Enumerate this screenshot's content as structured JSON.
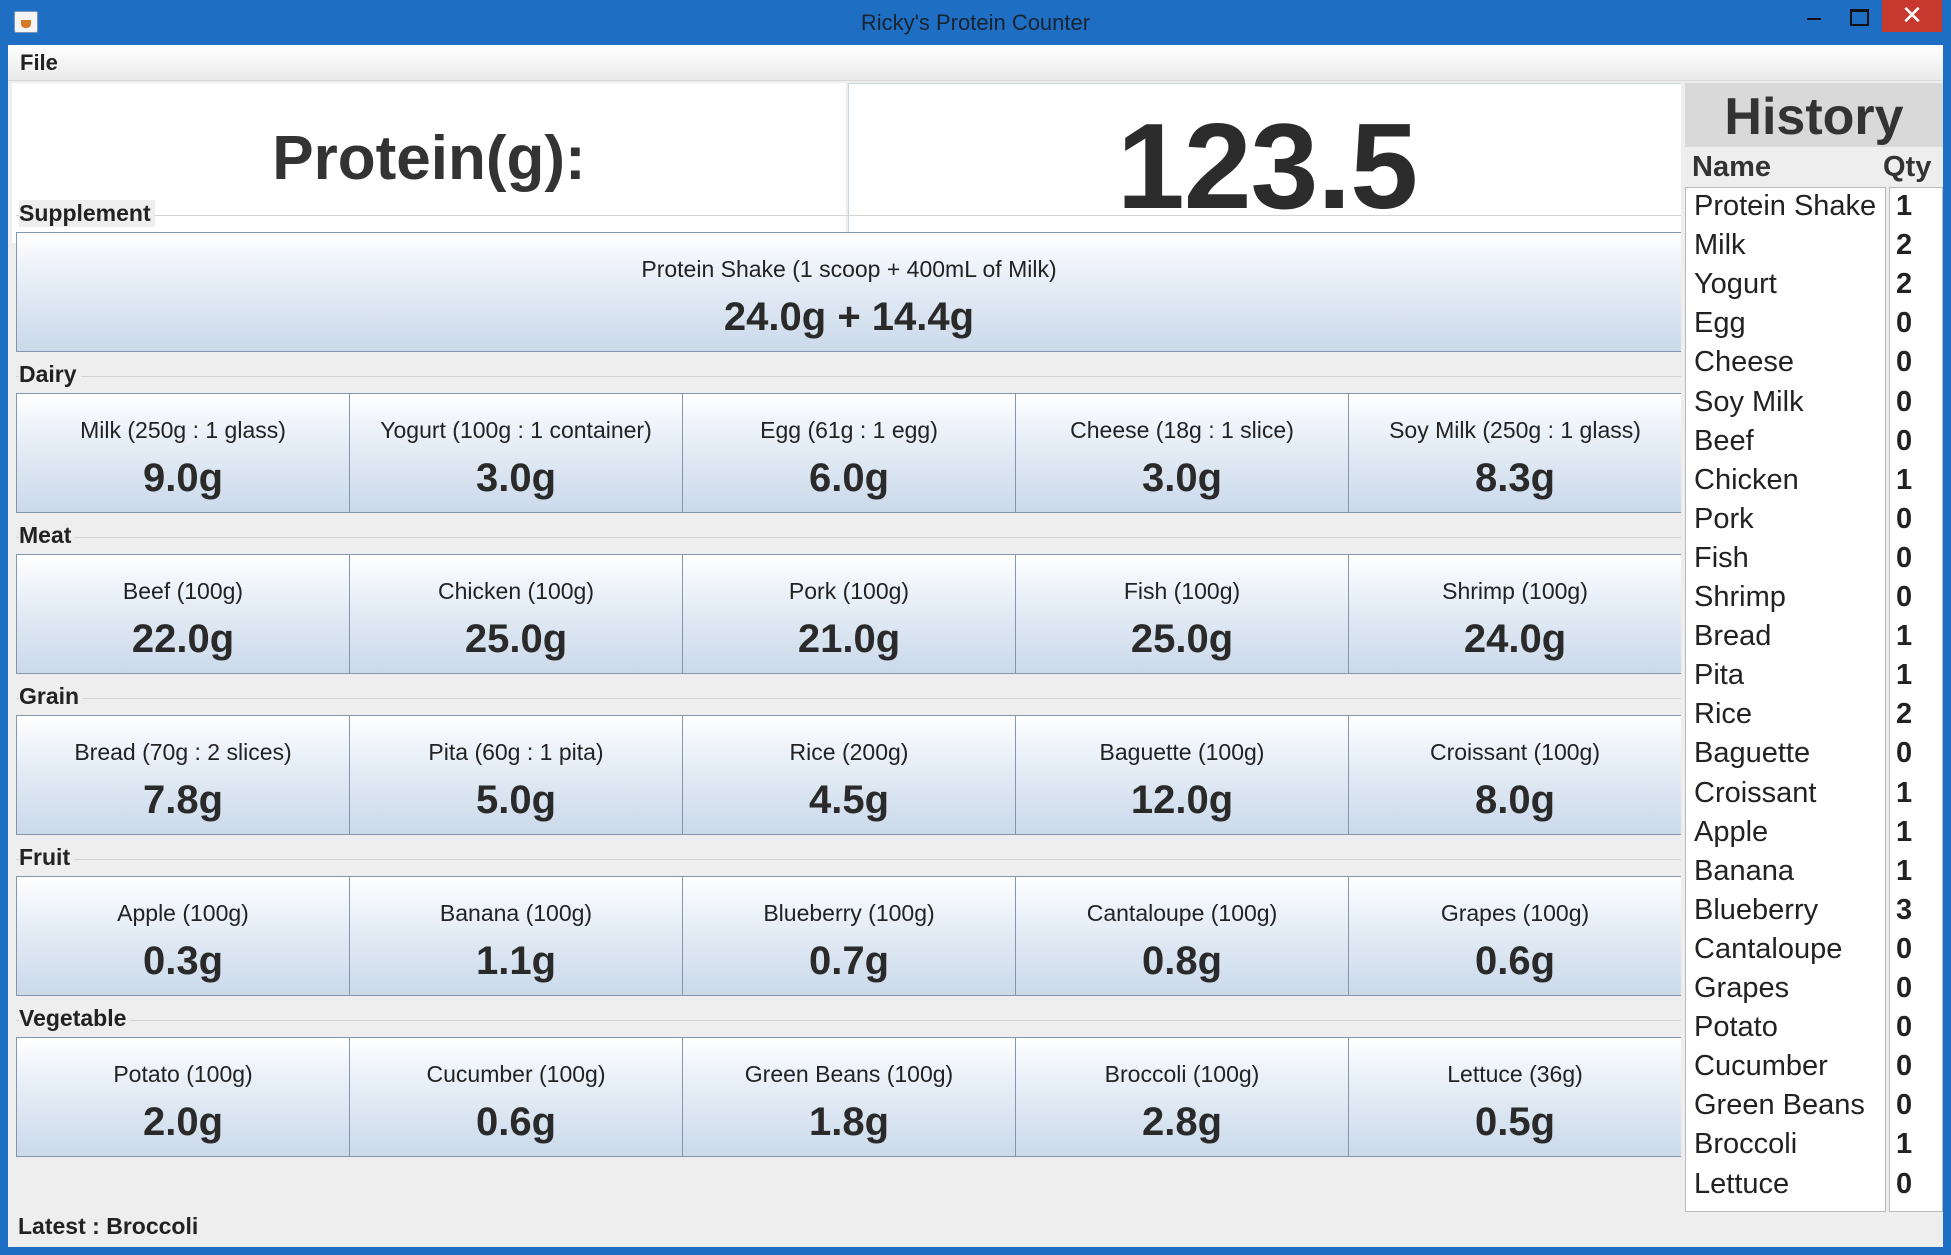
{
  "window": {
    "title": "Ricky's Protein Counter"
  },
  "menu": {
    "file": "File"
  },
  "summary": {
    "label": "Protein(g):",
    "value": "123.5"
  },
  "sections": [
    {
      "title": "Supplement",
      "items": [
        {
          "name": "Protein Shake (1 scoop + 400mL of Milk)",
          "value": "24.0g + 14.4g"
        }
      ]
    },
    {
      "title": "Dairy",
      "items": [
        {
          "name": "Milk (250g : 1 glass)",
          "value": "9.0g"
        },
        {
          "name": "Yogurt (100g : 1 container)",
          "value": "3.0g"
        },
        {
          "name": "Egg (61g : 1 egg)",
          "value": "6.0g"
        },
        {
          "name": "Cheese (18g : 1 slice)",
          "value": "3.0g"
        },
        {
          "name": "Soy Milk (250g : 1 glass)",
          "value": "8.3g"
        }
      ]
    },
    {
      "title": "Meat",
      "items": [
        {
          "name": "Beef (100g)",
          "value": "22.0g"
        },
        {
          "name": "Chicken (100g)",
          "value": "25.0g"
        },
        {
          "name": "Pork (100g)",
          "value": "21.0g"
        },
        {
          "name": "Fish (100g)",
          "value": "25.0g"
        },
        {
          "name": "Shrimp (100g)",
          "value": "24.0g"
        }
      ]
    },
    {
      "title": "Grain",
      "items": [
        {
          "name": "Bread (70g : 2 slices)",
          "value": "7.8g"
        },
        {
          "name": "Pita (60g : 1 pita)",
          "value": "5.0g"
        },
        {
          "name": "Rice (200g)",
          "value": "4.5g"
        },
        {
          "name": "Baguette (100g)",
          "value": "12.0g"
        },
        {
          "name": "Croissant (100g)",
          "value": "8.0g"
        }
      ]
    },
    {
      "title": "Fruit",
      "items": [
        {
          "name": "Apple (100g)",
          "value": "0.3g"
        },
        {
          "name": "Banana (100g)",
          "value": "1.1g"
        },
        {
          "name": "Blueberry (100g)",
          "value": "0.7g"
        },
        {
          "name": "Cantaloupe (100g)",
          "value": "0.8g"
        },
        {
          "name": "Grapes (100g)",
          "value": "0.6g"
        }
      ]
    },
    {
      "title": "Vegetable",
      "items": [
        {
          "name": "Potato (100g)",
          "value": "2.0g"
        },
        {
          "name": "Cucumber (100g)",
          "value": "0.6g"
        },
        {
          "name": "Green Beans (100g)",
          "value": "1.8g"
        },
        {
          "name": "Broccoli (100g)",
          "value": "2.8g"
        },
        {
          "name": "Lettuce (36g)",
          "value": "0.5g"
        }
      ]
    }
  ],
  "status": {
    "label": "Latest",
    "separator": " : ",
    "value": "Broccoli"
  },
  "history": {
    "title": "History",
    "col_name": "Name",
    "col_qty": "Qty",
    "rows": [
      {
        "name": "Protein Shake",
        "qty": "1"
      },
      {
        "name": "Milk",
        "qty": "2"
      },
      {
        "name": "Yogurt",
        "qty": "2"
      },
      {
        "name": "Egg",
        "qty": "0"
      },
      {
        "name": "Cheese",
        "qty": "0"
      },
      {
        "name": "Soy Milk",
        "qty": "0"
      },
      {
        "name": "Beef",
        "qty": "0"
      },
      {
        "name": "Chicken",
        "qty": "1"
      },
      {
        "name": "Pork",
        "qty": "0"
      },
      {
        "name": "Fish",
        "qty": "0"
      },
      {
        "name": "Shrimp",
        "qty": "0"
      },
      {
        "name": "Bread",
        "qty": "1"
      },
      {
        "name": "Pita",
        "qty": "1"
      },
      {
        "name": "Rice",
        "qty": "2"
      },
      {
        "name": "Baguette",
        "qty": "0"
      },
      {
        "name": "Croissant",
        "qty": "1"
      },
      {
        "name": "Apple",
        "qty": "1"
      },
      {
        "name": "Banana",
        "qty": "1"
      },
      {
        "name": "Blueberry",
        "qty": "3"
      },
      {
        "name": "Cantaloupe",
        "qty": "0"
      },
      {
        "name": "Grapes",
        "qty": "0"
      },
      {
        "name": "Potato",
        "qty": "0"
      },
      {
        "name": "Cucumber",
        "qty": "0"
      },
      {
        "name": "Green Beans",
        "qty": "0"
      },
      {
        "name": "Broccoli",
        "qty": "1"
      },
      {
        "name": "Lettuce",
        "qty": "0"
      }
    ]
  }
}
